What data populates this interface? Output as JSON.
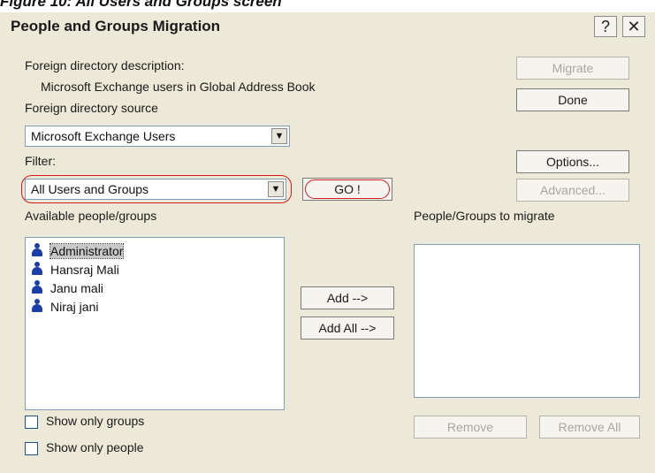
{
  "caption": "Figure 10: All Users and Groups screen",
  "dialog": {
    "title": "People and Groups Migration",
    "help_button": "?",
    "close_button": "✕"
  },
  "labels": {
    "foreign_dir_description_label": "Foreign directory description:",
    "foreign_dir_description_value": "Microsoft Exchange users in Global Address Book",
    "foreign_dir_source_label": "Foreign directory source",
    "filter_label": "Filter:",
    "available_label": "Available people/groups",
    "migrate_label": "People/Groups to migrate"
  },
  "source_combo": {
    "value": "Microsoft Exchange Users"
  },
  "filter_combo": {
    "value": "All Users and Groups"
  },
  "buttons": {
    "migrate": "Migrate",
    "done": "Done",
    "options": "Options...",
    "go": "GO !",
    "advanced": "Advanced...",
    "add": "Add -->",
    "add_all": "Add All -->",
    "remove": "Remove",
    "remove_all": "Remove All"
  },
  "available_list": [
    {
      "name": "Administrator",
      "selected": true,
      "icon": "user-icon"
    },
    {
      "name": "Hansraj Mali",
      "selected": false,
      "icon": "user-icon"
    },
    {
      "name": "Janu mali",
      "selected": false,
      "icon": "user-icon"
    },
    {
      "name": "Niraj jani",
      "selected": false,
      "icon": "user-icon"
    }
  ],
  "migrate_list": [],
  "checkboxes": {
    "show_only_groups": {
      "label": "Show only groups",
      "checked": false
    },
    "show_only_people": {
      "label": "Show only people",
      "checked": false
    }
  },
  "colors": {
    "dialog_bg": "#ece9d8",
    "highlight_oval": "#d21a1a",
    "user_icon": "#1b3fa8"
  }
}
